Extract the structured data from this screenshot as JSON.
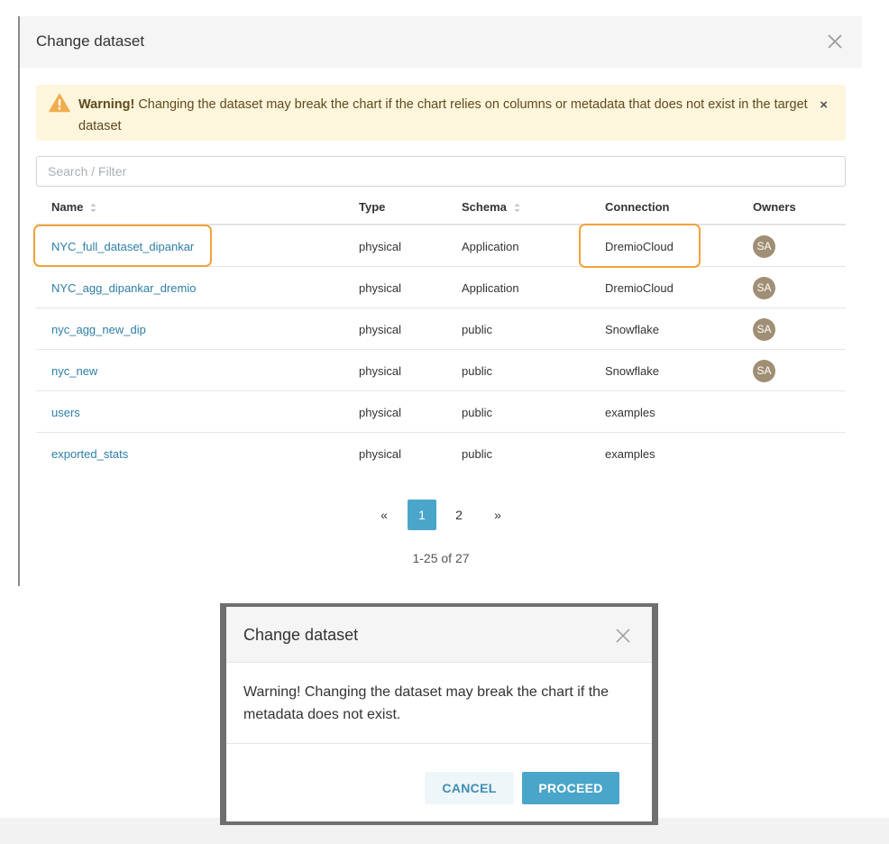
{
  "top_modal": {
    "title": "Change dataset",
    "warning": {
      "strong": "Warning!",
      "text": " Changing the dataset may break the chart if the chart relies on columns or metadata that does not exist in the target dataset",
      "close": "×"
    },
    "search": {
      "placeholder": "Search / Filter",
      "value": ""
    },
    "table": {
      "columns": [
        "Name",
        "Type",
        "Schema",
        "Connection",
        "Owners"
      ],
      "rows": [
        {
          "name": "NYC_full_dataset_dipankar",
          "type": "physical",
          "schema": "Application",
          "connection": "DremioCloud",
          "owner": "SA"
        },
        {
          "name": "NYC_agg_dipankar_dremio",
          "type": "physical",
          "schema": "Application",
          "connection": "DremioCloud",
          "owner": "SA"
        },
        {
          "name": "nyc_agg_new_dip",
          "type": "physical",
          "schema": "public",
          "connection": "Snowflake",
          "owner": "SA"
        },
        {
          "name": "nyc_new",
          "type": "physical",
          "schema": "public",
          "connection": "Snowflake",
          "owner": "SA"
        },
        {
          "name": "users",
          "type": "physical",
          "schema": "public",
          "connection": "examples",
          "owner": ""
        },
        {
          "name": "exported_stats",
          "type": "physical",
          "schema": "public",
          "connection": "examples",
          "owner": ""
        }
      ]
    },
    "pagination": {
      "prev": "«",
      "pages": [
        "1",
        "2"
      ],
      "current": "1",
      "next": "»",
      "range": "1-25 of 27"
    }
  },
  "bottom_modal": {
    "title": "Change dataset",
    "body": "Warning! Changing the dataset may break the chart if the metadata does not exist.",
    "cancel_label": "CANCEL",
    "proceed_label": "PROCEED"
  },
  "colors": {
    "accent": "#4aa5ca",
    "link": "#2d7ea6",
    "highlight": "#f2a23b",
    "warning_bg": "#fdf6dc",
    "warning_icon": "#f0ad4e",
    "avatar": "#a08e75"
  },
  "icons": {
    "close": "close-icon",
    "warning": "warning-triangle-icon",
    "sort": "sort-icon"
  }
}
